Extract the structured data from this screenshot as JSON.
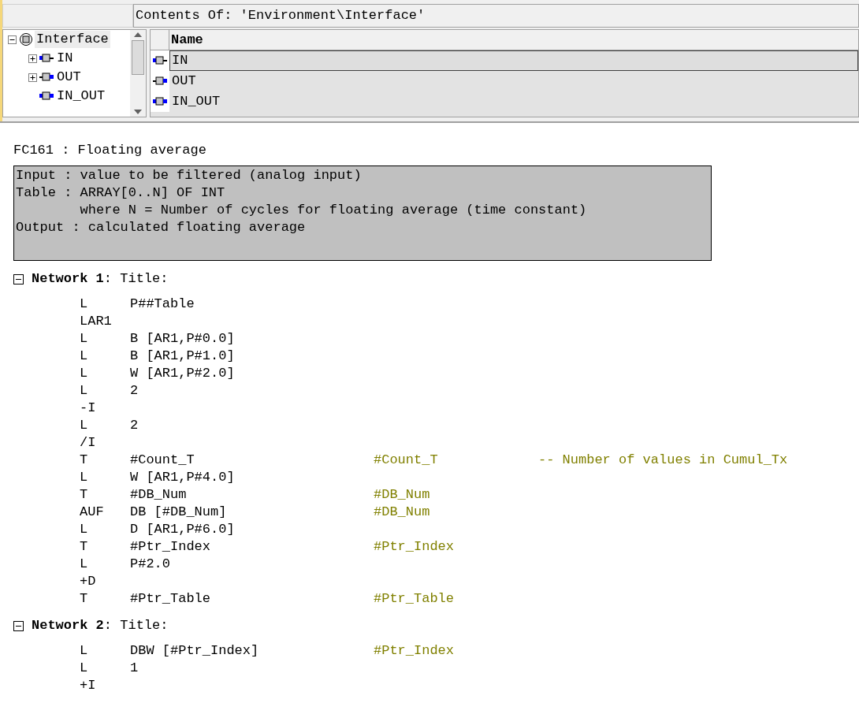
{
  "contents_header": "Contents Of: 'Environment\\Interface'",
  "tree": [
    {
      "label": "Interface",
      "kind": "root",
      "expanded": true,
      "selected": true,
      "children": [
        {
          "label": "IN",
          "kind": "in",
          "expanded": false,
          "selected": false
        },
        {
          "label": "OUT",
          "kind": "out",
          "expanded": false,
          "selected": false
        },
        {
          "label": "IN_OUT",
          "kind": "inout",
          "selected": false
        }
      ]
    }
  ],
  "table": {
    "columns": [
      "Name"
    ],
    "rows": [
      {
        "name": "IN",
        "kind": "in",
        "selected": true
      },
      {
        "name": "OUT",
        "kind": "out",
        "selected": false
      },
      {
        "name": "IN_OUT",
        "kind": "inout",
        "selected": false
      }
    ]
  },
  "block_title": "FC161 : Floating average",
  "block_comment": [
    "Input : value to be filtered (analog input)",
    "Table : ARRAY[0..N] OF INT",
    "        where N = Number of cycles for floating average (time constant)",
    "Output : calculated floating average"
  ],
  "networks": [
    {
      "name": "Network 1",
      "title": ": Title:",
      "expanded": true,
      "lines": [
        {
          "op": "L",
          "arg": "P##Table"
        },
        {
          "op": "LAR1"
        },
        {
          "op": "L",
          "arg": "B [AR1,P#0.0]"
        },
        {
          "op": "L",
          "arg": "B [AR1,P#1.0]"
        },
        {
          "op": "L",
          "arg": "W [AR1,P#2.0]"
        },
        {
          "op": "L",
          "arg": "2"
        },
        {
          "op": "-I"
        },
        {
          "op": "L",
          "arg": "2"
        },
        {
          "op": "/I"
        },
        {
          "op": "T",
          "arg": "#Count_T",
          "symbol": "#Count_T",
          "comment": "-- Number of values in Cumul_Tx"
        },
        {
          "op": "L",
          "arg": "W [AR1,P#4.0]"
        },
        {
          "op": "T",
          "arg": "#DB_Num",
          "symbol": "#DB_Num"
        },
        {
          "op": "AUF",
          "arg": "DB [#DB_Num]",
          "symbol": "#DB_Num"
        },
        {
          "op": "L",
          "arg": "D [AR1,P#6.0]"
        },
        {
          "op": "T",
          "arg": "#Ptr_Index",
          "symbol": "#Ptr_Index"
        },
        {
          "op": "L",
          "arg": "P#2.0"
        },
        {
          "op": "+D"
        },
        {
          "op": "T",
          "arg": "#Ptr_Table",
          "symbol": "#Ptr_Table"
        }
      ]
    },
    {
      "name": "Network 2",
      "title": ": Title:",
      "expanded": true,
      "lines": [
        {
          "op": "L",
          "arg": "DBW [#Ptr_Index]",
          "symbol": "#Ptr_Index"
        },
        {
          "op": "L",
          "arg": "1"
        },
        {
          "op": "+I"
        }
      ]
    }
  ]
}
